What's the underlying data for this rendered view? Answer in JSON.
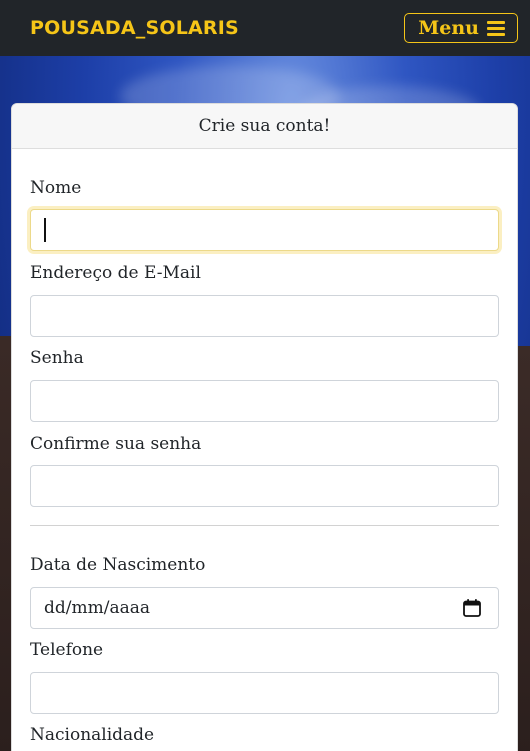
{
  "navbar": {
    "brand": "POUSADA_SOLARIS",
    "menu_label": "Menu",
    "menu_icon": "hamburger-icon",
    "accent_color": "#f5c518",
    "background_color": "#212529"
  },
  "form": {
    "title": "Crie sua conta!",
    "fields": {
      "nome": {
        "label": "Nome",
        "value": "",
        "focused": true
      },
      "email": {
        "label": "Endereço de E-Mail",
        "value": ""
      },
      "senha": {
        "label": "Senha",
        "value": ""
      },
      "confirmar": {
        "label": "Confirme sua senha",
        "value": ""
      },
      "nascimento": {
        "label": "Data de Nascimento",
        "value": "dd/mm/aaaa",
        "icon": "calendar-icon"
      },
      "telefone": {
        "label": "Telefone",
        "value": ""
      },
      "nacionalidade": {
        "label": "Nacionalidade"
      }
    }
  }
}
